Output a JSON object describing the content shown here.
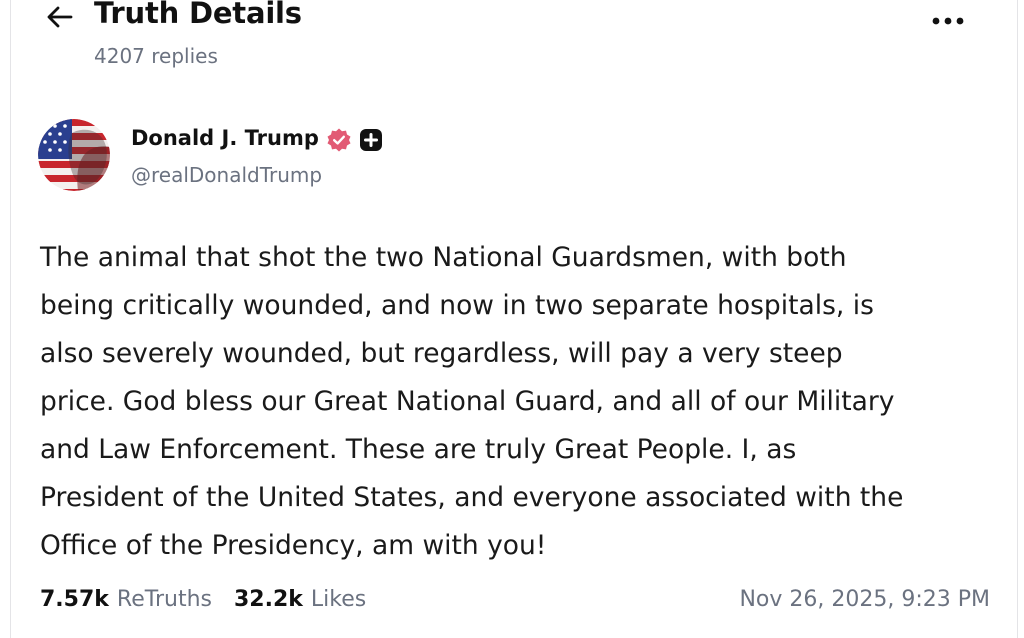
{
  "header": {
    "title": "Truth Details",
    "reply_count": "4207 replies",
    "back_icon": "arrow-left-icon",
    "more_icon": "more-horizontal-icon"
  },
  "author": {
    "name": "Donald J. Trump",
    "handle": "@realDonaldTrump",
    "verified_icon": "verified-badge-icon",
    "extra_badge_icon": "plus-badge-icon",
    "verified_color": "#e25a74"
  },
  "post": {
    "lines": [
      "The animal that shot the two National Guardsmen, with both",
      "being critically wounded, and now in two separate hospitals, is",
      "also severely wounded, but regardless, will pay a very steep",
      "price. God bless our Great National Guard, and all of our Military",
      "and Law Enforcement. These are truly Great People. I, as",
      "President of the United States, and everyone associated with the",
      "Office of the Presidency, am with you!"
    ]
  },
  "stats": {
    "retruths_count": "7.57k",
    "retruths_label": "ReTruths",
    "likes_count": "32.2k",
    "likes_label": "Likes",
    "timestamp": "Nov 26, 2025, 9:23 PM"
  },
  "colors": {
    "text_primary": "#111111",
    "text_secondary": "#6b7280"
  }
}
